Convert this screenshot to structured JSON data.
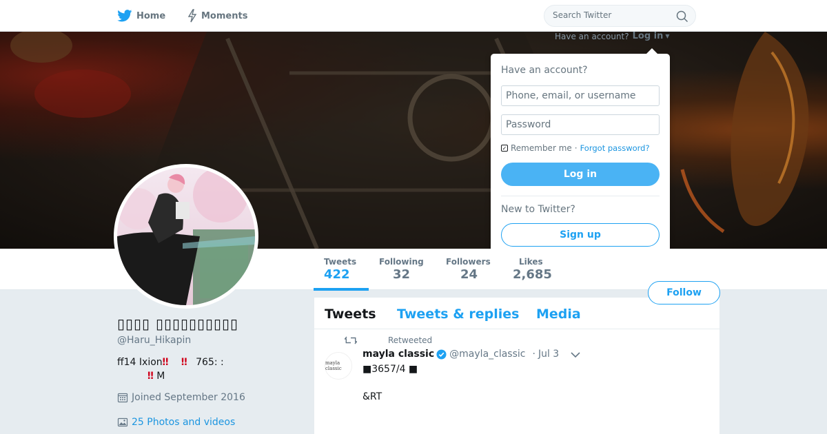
{
  "nav": {
    "home_label": "Home",
    "moments_label": "Moments",
    "search_placeholder": "Search Twitter"
  },
  "login_prompt": {
    "question": "Have an account?",
    "login_link": "Log in"
  },
  "login_dropdown": {
    "heading": "Have an account?",
    "username_placeholder": "Phone, email, or username",
    "password_placeholder": "Password",
    "remember_label": "Remember me",
    "separator": "·",
    "forgot_label": "Forgot password?",
    "login_button": "Log in",
    "new_heading": "New to Twitter?",
    "signup_button": "Sign up"
  },
  "stats": {
    "tweets_label": "Tweets",
    "tweets_value": "422",
    "following_label": "Following",
    "following_value": "32",
    "followers_label": "Followers",
    "followers_value": "24",
    "likes_label": "Likes",
    "likes_value": "2,685"
  },
  "follow_button": "Follow",
  "profile": {
    "fullname": "▯▯▯▯ ▯▯▯▯▯▯▯▯▯▯",
    "handle": "@Haru_Hikapin",
    "bio_line1_a": "ff14 Ixion",
    "bio_bang": "‼",
    "bio_line1_b": "765: :",
    "bio_line2_b": "M",
    "joined": "Joined September 2016",
    "photos_link": "25 Photos and videos"
  },
  "timeline": {
    "tabs": [
      "Tweets",
      "Tweets & replies",
      "Media"
    ],
    "tweet": {
      "retweeted_label": "Retweeted",
      "avatar_text": "mayla classic",
      "name": "mayla classic",
      "screen_name": "@mayla_classic",
      "dot": "·",
      "time": "Jul 3",
      "text": "■3657/4 ■\n\n&RT"
    }
  },
  "colors": {
    "accent": "#1da1f2",
    "login_button": "#4ab3f4",
    "background": "#e6ecf0",
    "bang": "#d0021b"
  },
  "icons": {
    "home": "bird-icon",
    "moments": "lightning-icon",
    "search": "search-icon",
    "retweet": "retweet-icon",
    "verified": "verified-badge-icon",
    "calendar": "calendar-icon",
    "photos": "photo-icon",
    "caret": "chevron-down-icon"
  }
}
